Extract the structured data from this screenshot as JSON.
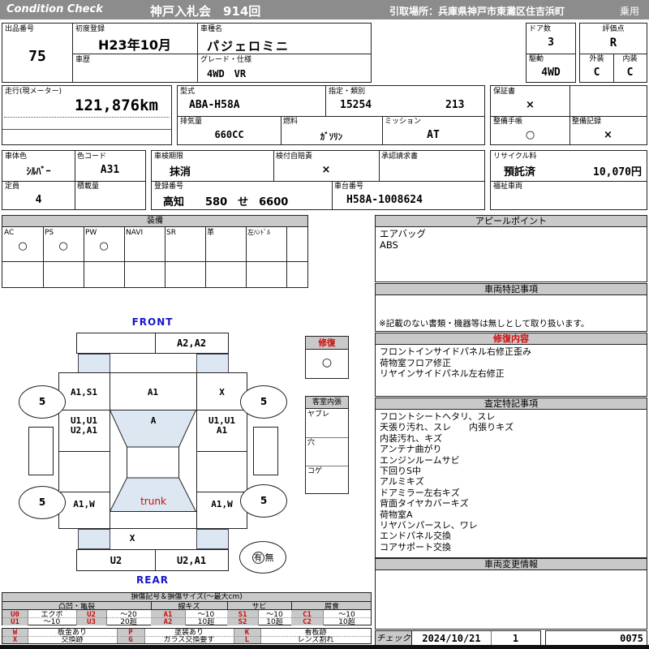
{
  "colors": {
    "header_bar": "#8c8c8c",
    "panel_header": "#c9c9c9",
    "highlight_blue": "#dce7f1",
    "accent_red": "#cf0a0a",
    "accent_blue": "#1616c8"
  },
  "header": {
    "brand": "Condition  Check",
    "auction_title": "神戸入札会　914回",
    "pickup_location": "引取場所：兵庫県神戸市東灘区住吉浜町",
    "category": "乗用"
  },
  "info": {
    "lot_label": "出品番号",
    "lot_no": "75",
    "first_reg_label": "初度登録",
    "first_reg": "H23年10月",
    "history_label": "車歴",
    "history": "",
    "model_label": "車種名",
    "model_name": "パジェロミニ",
    "grade_label": "グレード・仕様",
    "grade": "4WD　VR",
    "doors_label": "ドア数",
    "doors": "3",
    "drive_label": "駆動",
    "drive": "4WD",
    "score_label": "評価点",
    "score": "R",
    "ext_label": "外装",
    "ext": "C",
    "int_label": "内装",
    "int": "C",
    "mileage_label": "走行(現メーター)",
    "mileage": "121,876km",
    "model_code_label": "型式",
    "model_code": "ABA-H58A",
    "class_label": "指定・類別",
    "class_no1": "15254",
    "class_no2": "213",
    "disp_label": "排気量",
    "displacement": "660CC",
    "fuel_label": "燃料",
    "fuel": "ｶﾞｿﾘﾝ",
    "mission_label": "ミッション",
    "mission": "AT",
    "warranty_label": "保証書",
    "warranty": "×",
    "book_label": "整備手帳",
    "book": "○",
    "record_label": "整備記録",
    "record": "×",
    "body_color_label": "車体色",
    "body_color": "ｼﾙﾊﾞｰ",
    "color_code_label": "色コード",
    "color_code": "A31",
    "shaken_label": "車検期限",
    "shaken": "抹消",
    "jibaiseki_label": "検付自賠責",
    "jibaiseki": "×",
    "approval_label": "承認請求書",
    "capacity_label": "定員",
    "capacity": "4",
    "load_label": "積載量",
    "load": "",
    "regno_label": "登録番号",
    "regno": "高知　　580　せ　6600",
    "chassis_label": "車台番号",
    "chassis": "H58A-1008624",
    "recycle_label": "リサイクル料",
    "recycle_status": "預託済",
    "recycle_fee": "10,070円",
    "welfare_label": "福祉車両"
  },
  "equipment": {
    "title": "装備",
    "items": [
      {
        "label": "AC",
        "value": "○"
      },
      {
        "label": "PS",
        "value": "○"
      },
      {
        "label": "PW",
        "value": "○"
      },
      {
        "label": "NAVI",
        "value": ""
      },
      {
        "label": "SR",
        "value": ""
      },
      {
        "label": "革",
        "value": ""
      },
      {
        "label": "左ﾊﾝﾄﾞﾙ",
        "value": ""
      }
    ]
  },
  "panels": {
    "appeal": {
      "title": "アピールポイント",
      "lines": [
        "エアバッグ",
        "ABS"
      ]
    },
    "vehicle_notes": {
      "title": "車両特記事項",
      "note": "※記載のない書類・機器等は無しとして取り扱います。"
    },
    "repair": {
      "title": "修復内容",
      "lines": [
        "フロントインサイドパネル右修正歪み",
        "荷物室フロア修正",
        "リヤインサイドパネル左右修正"
      ]
    },
    "assessment": {
      "title": "査定特記事項",
      "lines": [
        "フロントシートヘタリ、スレ",
        "天張り汚れ、スレ　　内張りキズ",
        "内装汚れ、キズ",
        "アンテナ曲がり",
        "エンジンルームサビ",
        "下回りS中",
        "アルミキズ",
        "ドアミラー左右キズ",
        "背面タイヤカバーキズ",
        "荷物室A",
        "リヤバンパースレ、ワレ",
        "エンドパネル交換",
        "コアサポート交換"
      ]
    },
    "change_info": {
      "title": "車両変更情報"
    },
    "check": {
      "label": "チェック",
      "date": "2024/10/21",
      "count": "1",
      "sheet_no": "0075"
    }
  },
  "diagram": {
    "front_label": "FRONT",
    "rear_label": "REAR",
    "wheel_size": "5",
    "front_bumper_right": "A2,A2",
    "front_fender_left": "A1,S1",
    "hood": "A1",
    "front_fender_right": "X",
    "door_left_1": "U1,U1",
    "door_left_2": "U2,A1",
    "door_right_1": "U1,U1",
    "door_right_2": "A1",
    "windshield": "A",
    "trunk": "trunk",
    "rear_quarter_left": "A1,W",
    "rear_quarter_right": "A1,W",
    "rear_panel": "X",
    "rear_bumper_left": "U2",
    "rear_bumper_right": "U2,A1",
    "repair_box": {
      "title": "修復",
      "value": "○"
    },
    "cabin_box": {
      "title": "客室内張",
      "rows": [
        "ヤブレ",
        "穴",
        "コゲ"
      ]
    },
    "presence": {
      "yes": "有",
      "no": "無"
    }
  },
  "legend": {
    "title": "損傷記号＆損傷サイズ(～最大cm)",
    "groups": [
      "凸凹・亀裂",
      "線キズ",
      "サビ",
      "腐食"
    ],
    "row1": [
      "U0",
      "エクボ",
      "U2",
      "～20",
      "A1",
      "～10",
      "S1",
      "～10",
      "C1",
      "～10"
    ],
    "row2": [
      "U1",
      "～10",
      "U3",
      "20超",
      "A2",
      "10超",
      "S2",
      "10超",
      "C2",
      "10超"
    ],
    "marks1": [
      "W",
      "板金あり",
      "P",
      "塗装あり",
      "K",
      "看板跡"
    ],
    "marks2": [
      "X",
      "交換跡",
      "G",
      "ガラス交換要す",
      "L",
      "レンズ割れ"
    ]
  }
}
